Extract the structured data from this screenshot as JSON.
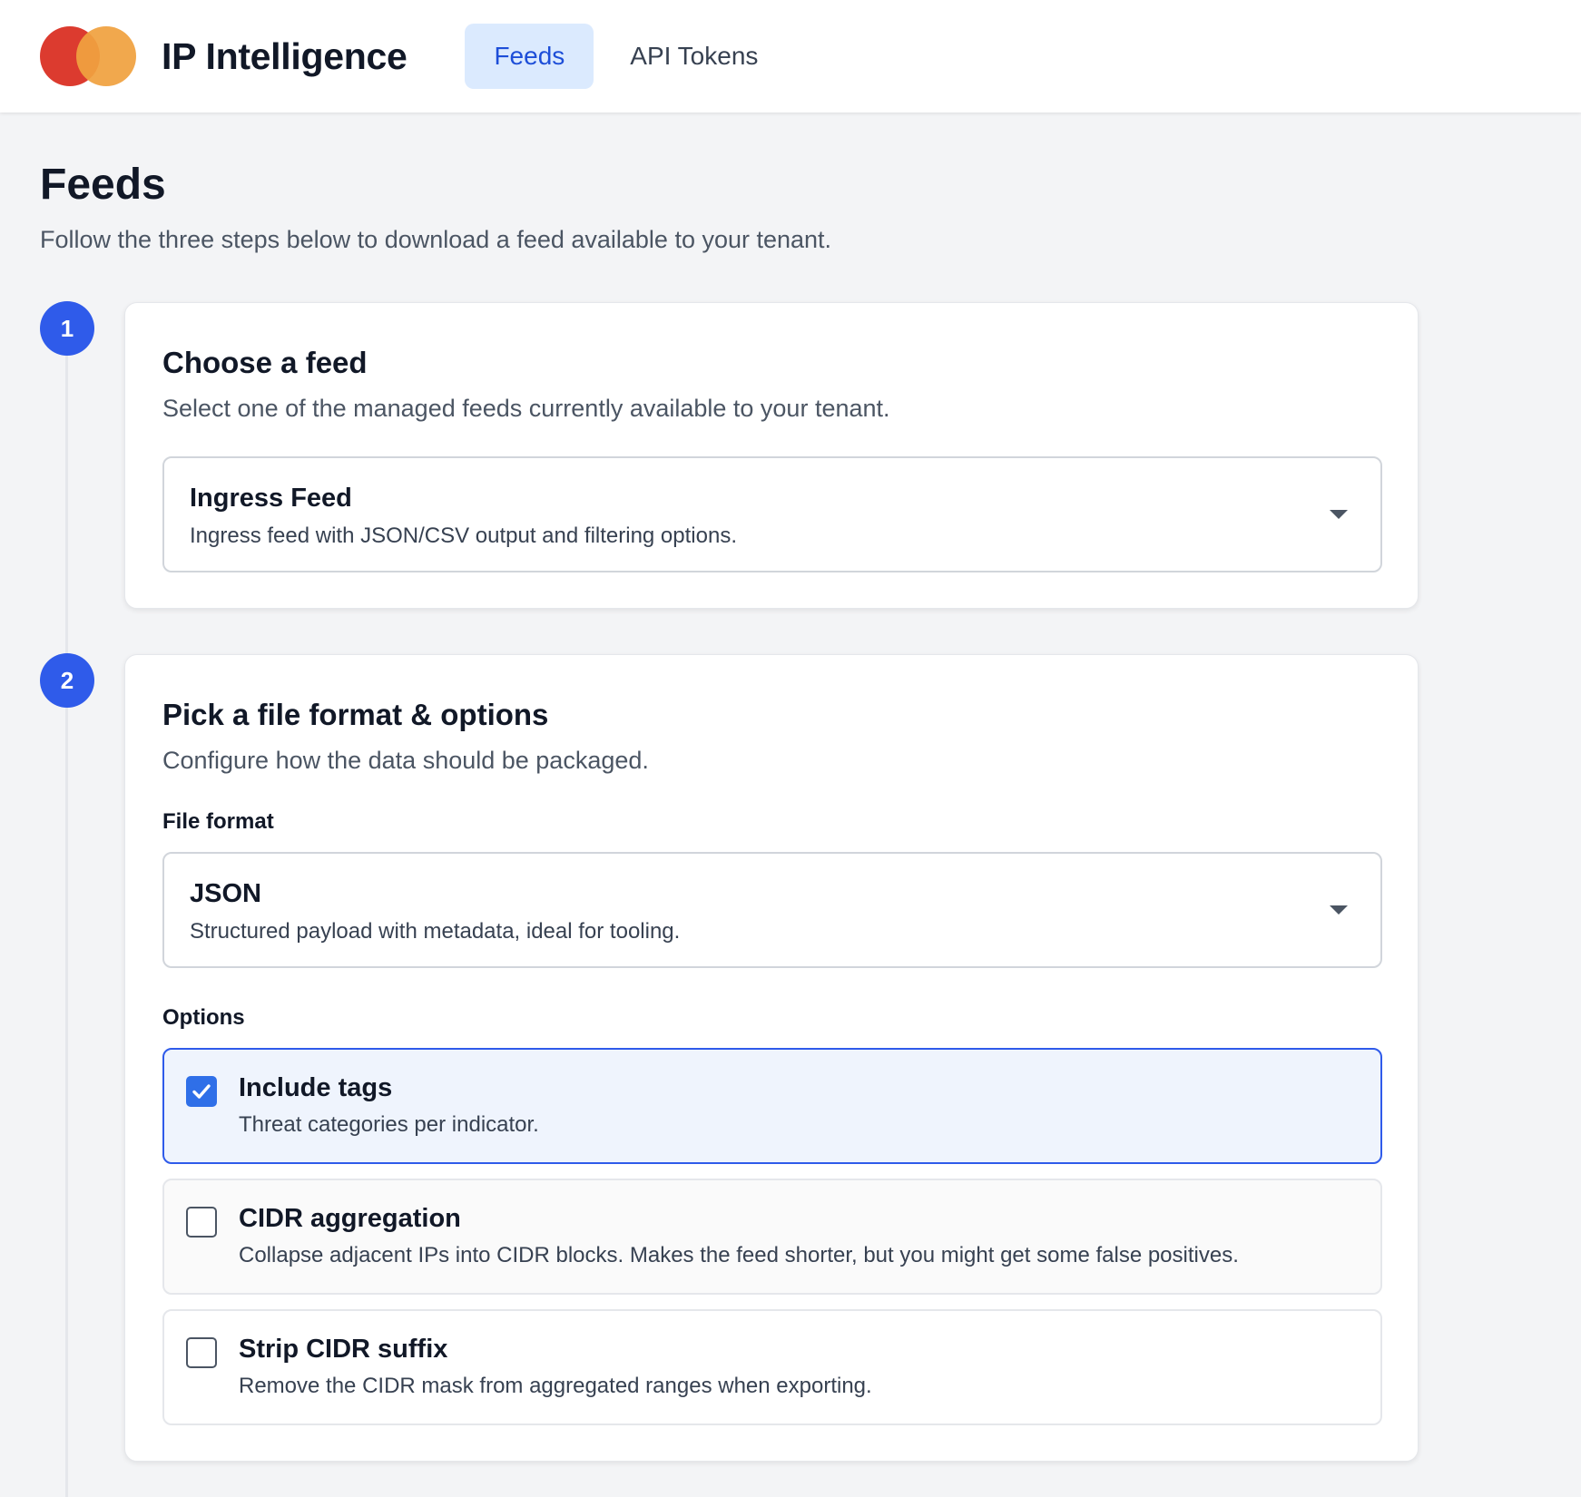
{
  "header": {
    "brand": "IP Intelligence",
    "logo_colors": [
      "#dc3b2f",
      "#f0a13f"
    ],
    "tabs": [
      {
        "label": "Feeds",
        "active": true
      },
      {
        "label": "API Tokens",
        "active": false
      }
    ]
  },
  "page": {
    "title": "Feeds",
    "subtitle": "Follow the three steps below to download a feed available to your tenant."
  },
  "steps": [
    {
      "number": "1",
      "title": "Choose a feed",
      "description": "Select one of the managed feeds currently available to your tenant.",
      "feed_select": {
        "selected_title": "Ingress Feed",
        "selected_description": "Ingress feed with JSON/CSV output and filtering options."
      }
    },
    {
      "number": "2",
      "title": "Pick a file format & options",
      "description": "Configure how the data should be packaged.",
      "format_label": "File format",
      "format_select": {
        "selected_title": "JSON",
        "selected_description": "Structured payload with metadata, ideal for tooling."
      },
      "options_label": "Options",
      "options": [
        {
          "title": "Include tags",
          "description": "Threat categories per indicator.",
          "checked": true
        },
        {
          "title": "CIDR aggregation",
          "description": "Collapse adjacent IPs into CIDR blocks. Makes the feed shorter, but you might get some false positives.",
          "checked": false
        },
        {
          "title": "Strip CIDR suffix",
          "description": "Remove the CIDR mask from aggregated ranges when exporting.",
          "checked": false
        }
      ]
    }
  ],
  "colors": {
    "accent": "#2f5bea",
    "active_tab_bg": "#dbeafe",
    "active_tab_text": "#1d4ed8",
    "checked_option_bg": "#eff4fd"
  }
}
